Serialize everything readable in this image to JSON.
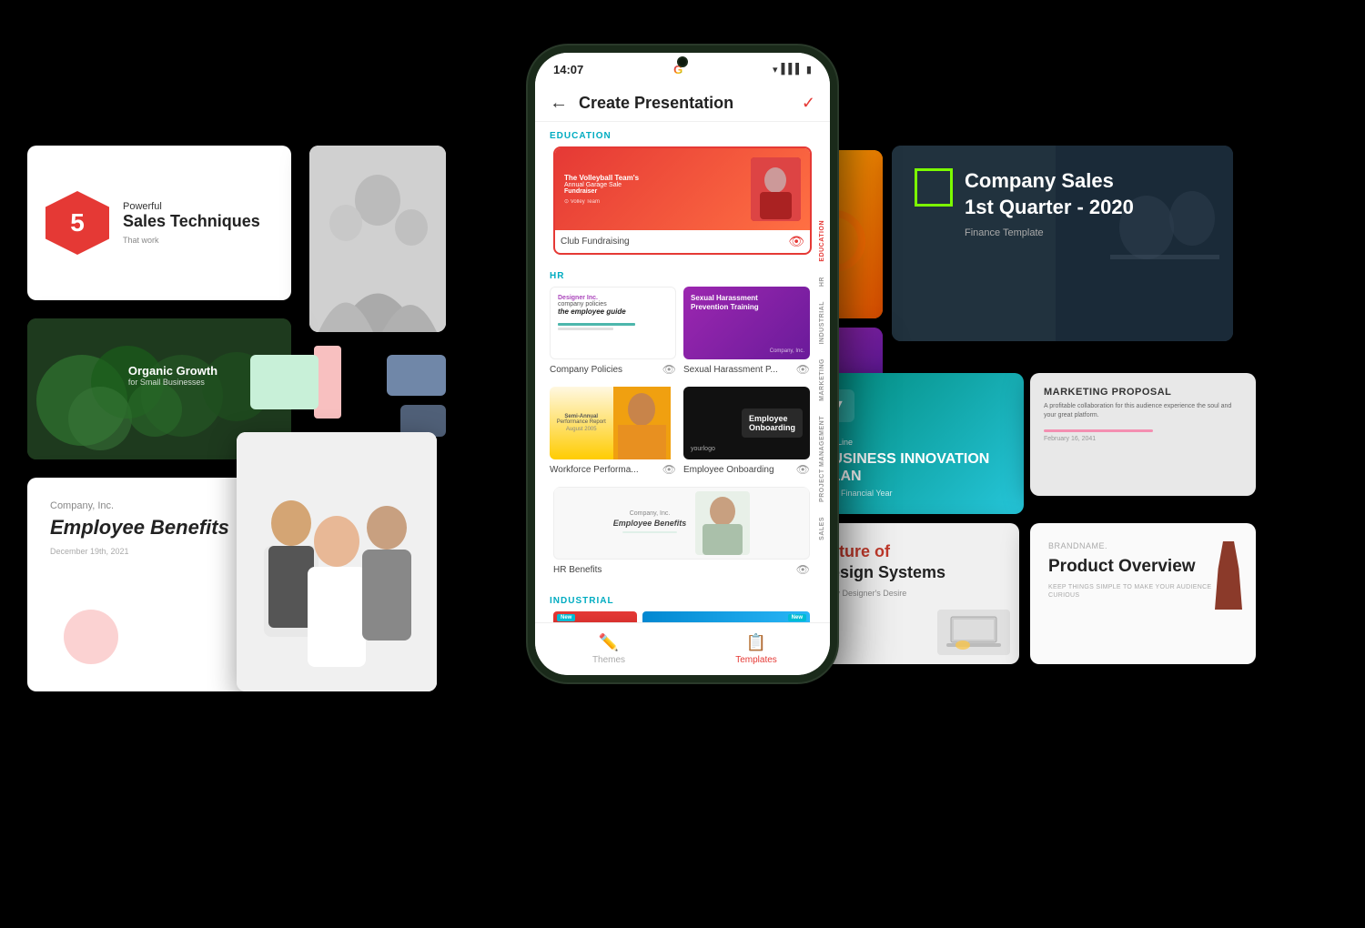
{
  "app": {
    "title": "Create Presentation",
    "time": "14:07",
    "google_logo": "G",
    "check_color": "#e53935"
  },
  "phone": {
    "camera_color": "#0d1a0d",
    "back_arrow": "←",
    "check_mark": "✓"
  },
  "sections": [
    {
      "id": "education",
      "label": "EDUCATION",
      "color": "#00acc1"
    },
    {
      "id": "hr",
      "label": "HR",
      "color": "#00acc1"
    },
    {
      "id": "industrial",
      "label": "INDUSTRIAL",
      "color": "#00acc1"
    }
  ],
  "templates": {
    "education": [
      {
        "name": "Club Fundraising",
        "selected": true,
        "theme": "red-sports"
      }
    ],
    "hr": [
      {
        "name": "Company Policies",
        "theme": "white-text"
      },
      {
        "name": "Sexual Harassment P...",
        "theme": "purple"
      },
      {
        "name": "Workforce Performa...",
        "theme": "orange"
      },
      {
        "name": "Employee Onboarding",
        "theme": "dark"
      },
      {
        "name": "HR Benefits",
        "theme": "light"
      }
    ]
  },
  "side_tabs": [
    {
      "label": "EDUCATION",
      "active": true
    },
    {
      "label": "HR",
      "active": false
    },
    {
      "label": "INDUSTRIAL",
      "active": false
    },
    {
      "label": "MARKETING",
      "active": false
    },
    {
      "label": "PROJECT MANAGEMENT",
      "active": false
    },
    {
      "label": "SALES",
      "active": false
    }
  ],
  "bottom_nav": [
    {
      "label": "Themes",
      "icon": "✏️",
      "active": false
    },
    {
      "label": "Templates",
      "icon": "📋",
      "active": true
    }
  ],
  "background_cards": {
    "sales_title": "Sales Techniques",
    "sales_number": "5",
    "sales_adjective": "Powerful",
    "sales_sub": "That work",
    "plants_title": "Organic Growth",
    "plants_sub": "for Small Businesses",
    "employee_company": "Company, Inc.",
    "employee_title": "Employee Benefits",
    "employee_date": "December 19th, 2021",
    "company_sales_title": "Company Sales 1st Quarter - 2020",
    "company_sales_sub": "Finance Template",
    "business_tag": "Tag Line",
    "business_title": "BUSINESS INNOVATION PLAN",
    "business_sub": "Real Financial Year",
    "marketing_title": "MARKETING PROPOSAL",
    "marketing_sub": "A profitable collaboration for this audience experience the soul and your great platform.",
    "future_title": "Future of Design Systems",
    "future_sub": "Every Designer's Desire",
    "product_title": "Product Overview",
    "product_sub": "KEEP THINGS SIMPLE TO MAKE YOUR AUDIENCE CURIOUS"
  }
}
